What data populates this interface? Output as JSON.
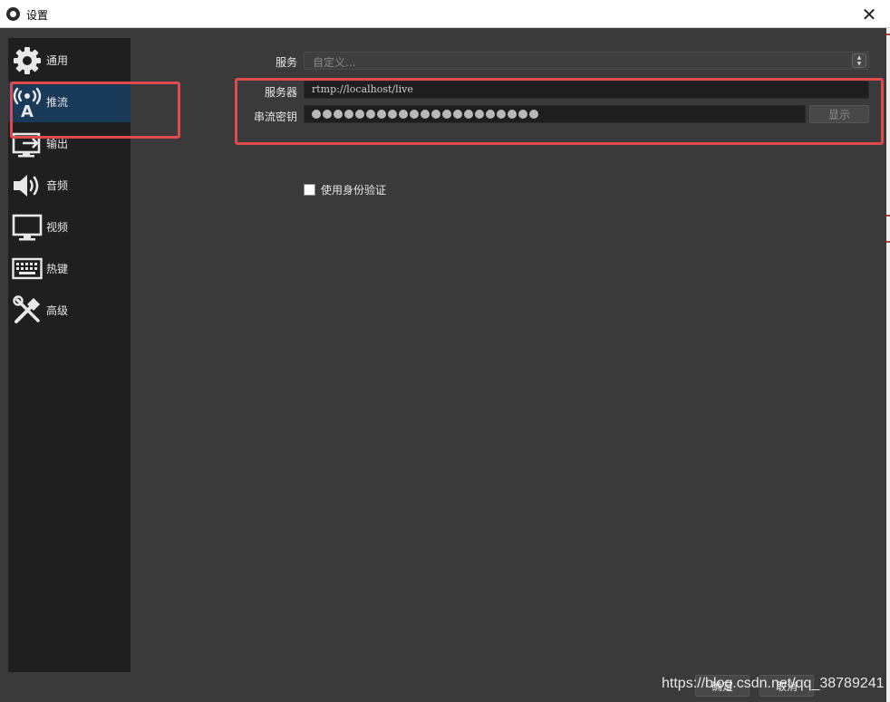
{
  "window": {
    "title": "设置",
    "close_glyph": "✕"
  },
  "sidebar": {
    "items": [
      {
        "label": "通用",
        "icon": "gear-icon"
      },
      {
        "label": "推流",
        "icon": "broadcast-tower-icon",
        "active": true
      },
      {
        "label": "输出",
        "icon": "output-icon"
      },
      {
        "label": "音频",
        "icon": "speaker-icon"
      },
      {
        "label": "视频",
        "icon": "monitor-icon"
      },
      {
        "label": "热键",
        "icon": "keyboard-icon"
      },
      {
        "label": "高级",
        "icon": "tools-icon"
      }
    ]
  },
  "stream": {
    "service_label": "服务",
    "service_value": "自定义...",
    "server_label": "服务器",
    "server_value": "rtmp://localhost/live",
    "key_label": "串流密钥",
    "key_masked_count": 21,
    "show_button": "显示",
    "auth_checkbox_label": "使用身份验证",
    "auth_checked": false
  },
  "footer": {
    "ok_label": "确定",
    "cancel_label": "取消",
    "watermark": "https://blog.csdn.net/qq_38789241"
  },
  "colors": {
    "highlight": "#e04a4a",
    "active_nav": "#1a3a5a",
    "sidebar_bg": "#1f1f1f",
    "content_bg": "#3a3a3a"
  }
}
